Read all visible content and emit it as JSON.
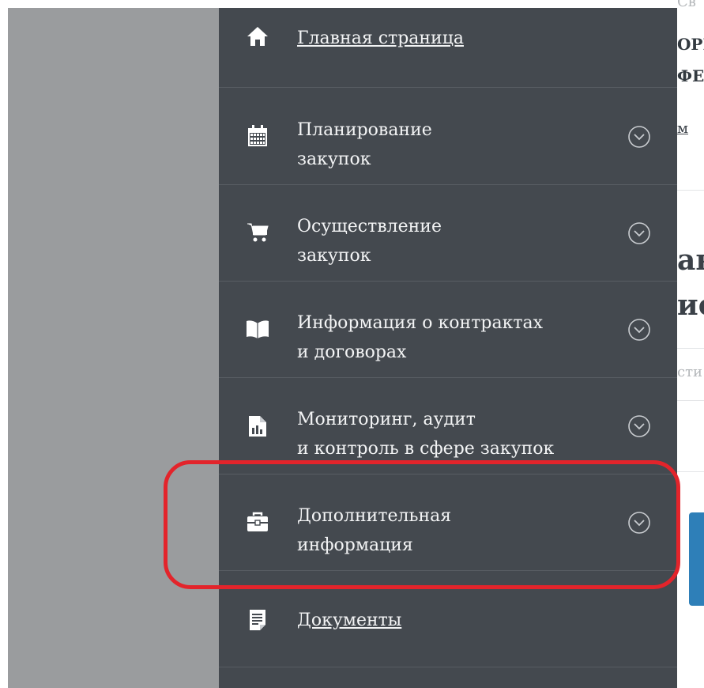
{
  "background_page": {
    "fragments": [
      "Св",
      "ОРГ",
      "ФЕР",
      "м",
      "ан",
      "ис",
      "сти"
    ]
  },
  "sidebar": {
    "items": [
      {
        "label": "Главная страница",
        "link": true,
        "icon": "home-icon",
        "expandable": false
      },
      {
        "label_line1": "Планирование",
        "label_line2": "закупок",
        "icon": "calendar-icon",
        "expandable": true
      },
      {
        "label_line1": "Осуществление",
        "label_line2": "закупок",
        "icon": "cart-icon",
        "expandable": true
      },
      {
        "label_line1": "Информация о контрактах",
        "label_line2": "и договорах",
        "icon": "book-icon",
        "expandable": true
      },
      {
        "label_line1": "Мониторинг, аудит",
        "label_line2": "и контроль в сфере закупок",
        "icon": "report-chart-icon",
        "expandable": true
      },
      {
        "label_line1": "Дополнительная",
        "label_line2": "информация",
        "icon": "briefcase-icon",
        "expandable": true,
        "highlighted": true
      },
      {
        "label": "Документы",
        "link": true,
        "icon": "document-icon",
        "expandable": false
      }
    ]
  },
  "colors": {
    "sidebar_bg": "#44494f",
    "overlay": "#9a9c9e",
    "highlight": "#e3242b",
    "text": "#f3f4f5"
  }
}
